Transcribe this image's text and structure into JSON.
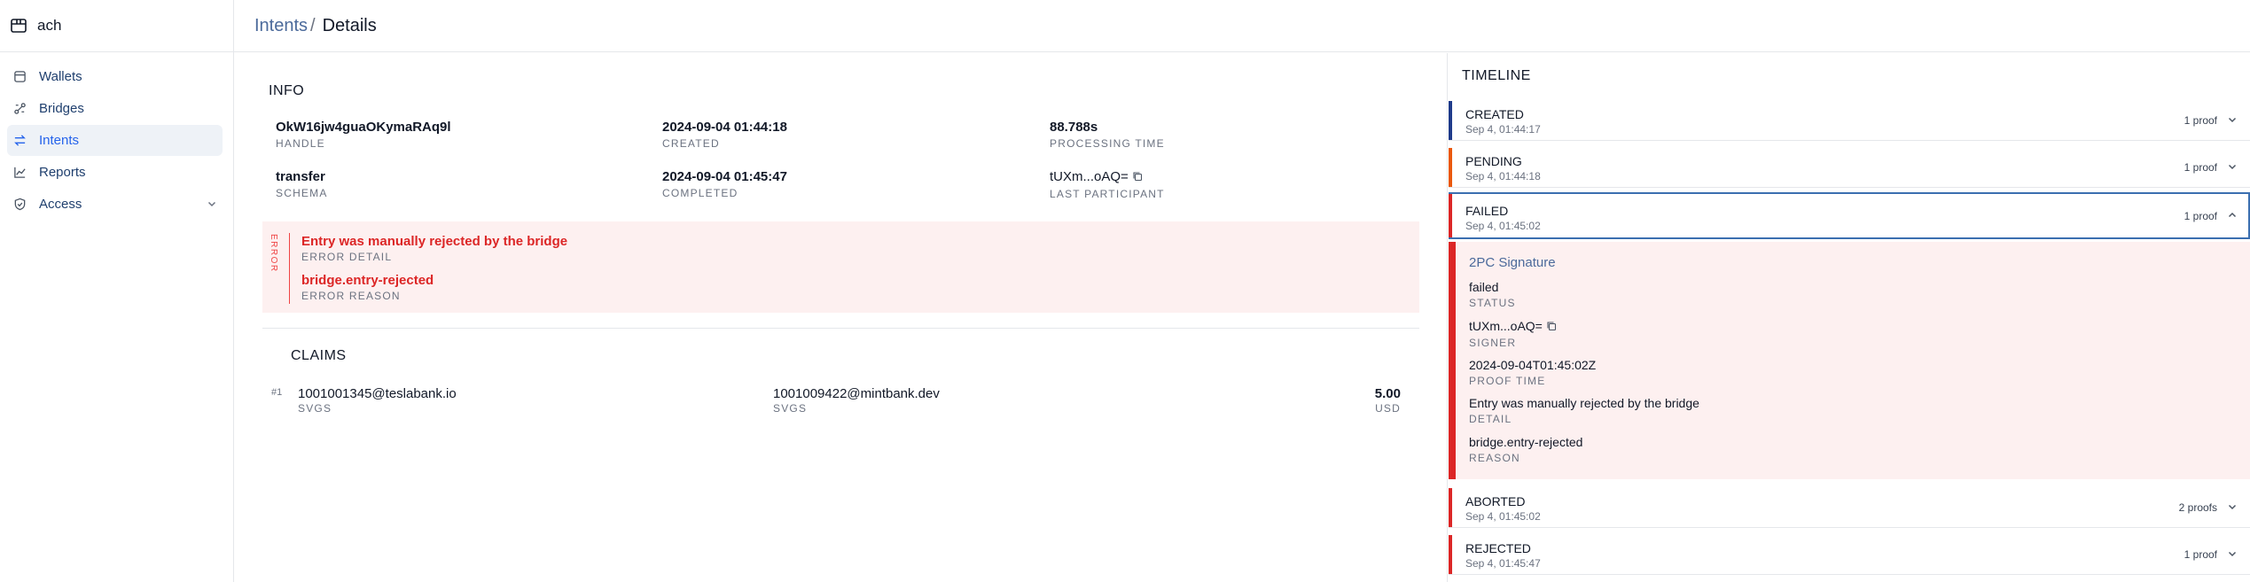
{
  "app": {
    "name": "ach"
  },
  "sidebar": {
    "items": [
      {
        "label": "Wallets",
        "icon": "wallet-icon"
      },
      {
        "label": "Bridges",
        "icon": "bridge-icon"
      },
      {
        "label": "Intents",
        "icon": "arrows-exchange-icon",
        "active": true
      },
      {
        "label": "Reports",
        "icon": "chart-line-icon"
      },
      {
        "label": "Access",
        "icon": "shield-check-icon"
      }
    ]
  },
  "header": {
    "breadcrumb_parent": "Intents",
    "breadcrumb_sep": "/",
    "breadcrumb_current": "Details"
  },
  "info": {
    "title": "INFO",
    "handle": {
      "value": "OkW16jw4guaOKymaRAq9l",
      "label": "HANDLE"
    },
    "created": {
      "value": "2024-09-04 01:44:18",
      "label": "CREATED"
    },
    "processing_time": {
      "value": "88.788s",
      "label": "PROCESSING TIME"
    },
    "schema": {
      "value": "transfer",
      "label": "SCHEMA"
    },
    "completed": {
      "value": "2024-09-04 01:45:47",
      "label": "COMPLETED"
    },
    "last_participant": {
      "value": "tUXm...oAQ=",
      "label": "LAST PARTICIPANT"
    }
  },
  "error": {
    "tag": "ERROR",
    "detail": {
      "value": "Entry was manually rejected by the bridge",
      "label": "ERROR DETAIL"
    },
    "reason": {
      "value": "bridge.entry-rejected",
      "label": "ERROR REASON"
    }
  },
  "claims": {
    "title": "CLAIMS",
    "rows": [
      {
        "index": "#1",
        "source": {
          "value": "1001001345@teslabank.io",
          "label": "SVGS"
        },
        "target": {
          "value": "1001009422@mintbank.dev",
          "label": "SVGS"
        },
        "amount": {
          "value": "5.00",
          "label": "USD"
        }
      }
    ]
  },
  "timeline": {
    "title": "TIMELINE",
    "items": [
      {
        "status": "CREATED",
        "time": "Sep 4, 01:44:17",
        "proofs": "1 proof",
        "color": "#1e3a8a"
      },
      {
        "status": "PENDING",
        "time": "Sep 4, 01:44:18",
        "proofs": "1 proof",
        "color": "#ea580c"
      },
      {
        "status": "FAILED",
        "time": "Sep 4, 01:45:02",
        "proofs": "1 proof",
        "color": "#dc2626",
        "expanded": true
      },
      {
        "status": "ABORTED",
        "time": "Sep 4, 01:45:02",
        "proofs": "2 proofs",
        "color": "#dc2626"
      },
      {
        "status": "REJECTED",
        "time": "Sep 4, 01:45:47",
        "proofs": "1 proof",
        "color": "#dc2626"
      }
    ],
    "detail": {
      "title": "2PC Signature",
      "status": {
        "value": "failed",
        "label": "STATUS"
      },
      "signer": {
        "value": "tUXm...oAQ=",
        "label": "SIGNER"
      },
      "proof_time": {
        "value": "2024-09-04T01:45:02Z",
        "label": "PROOF TIME"
      },
      "detail": {
        "value": "Entry was manually rejected by the bridge",
        "label": "DETAIL"
      },
      "reason": {
        "value": "bridge.entry-rejected",
        "label": "REASON"
      }
    }
  },
  "colors": {
    "accent": "#2563eb",
    "error": "#dc2626",
    "error_bg": "#fdf0f0"
  }
}
